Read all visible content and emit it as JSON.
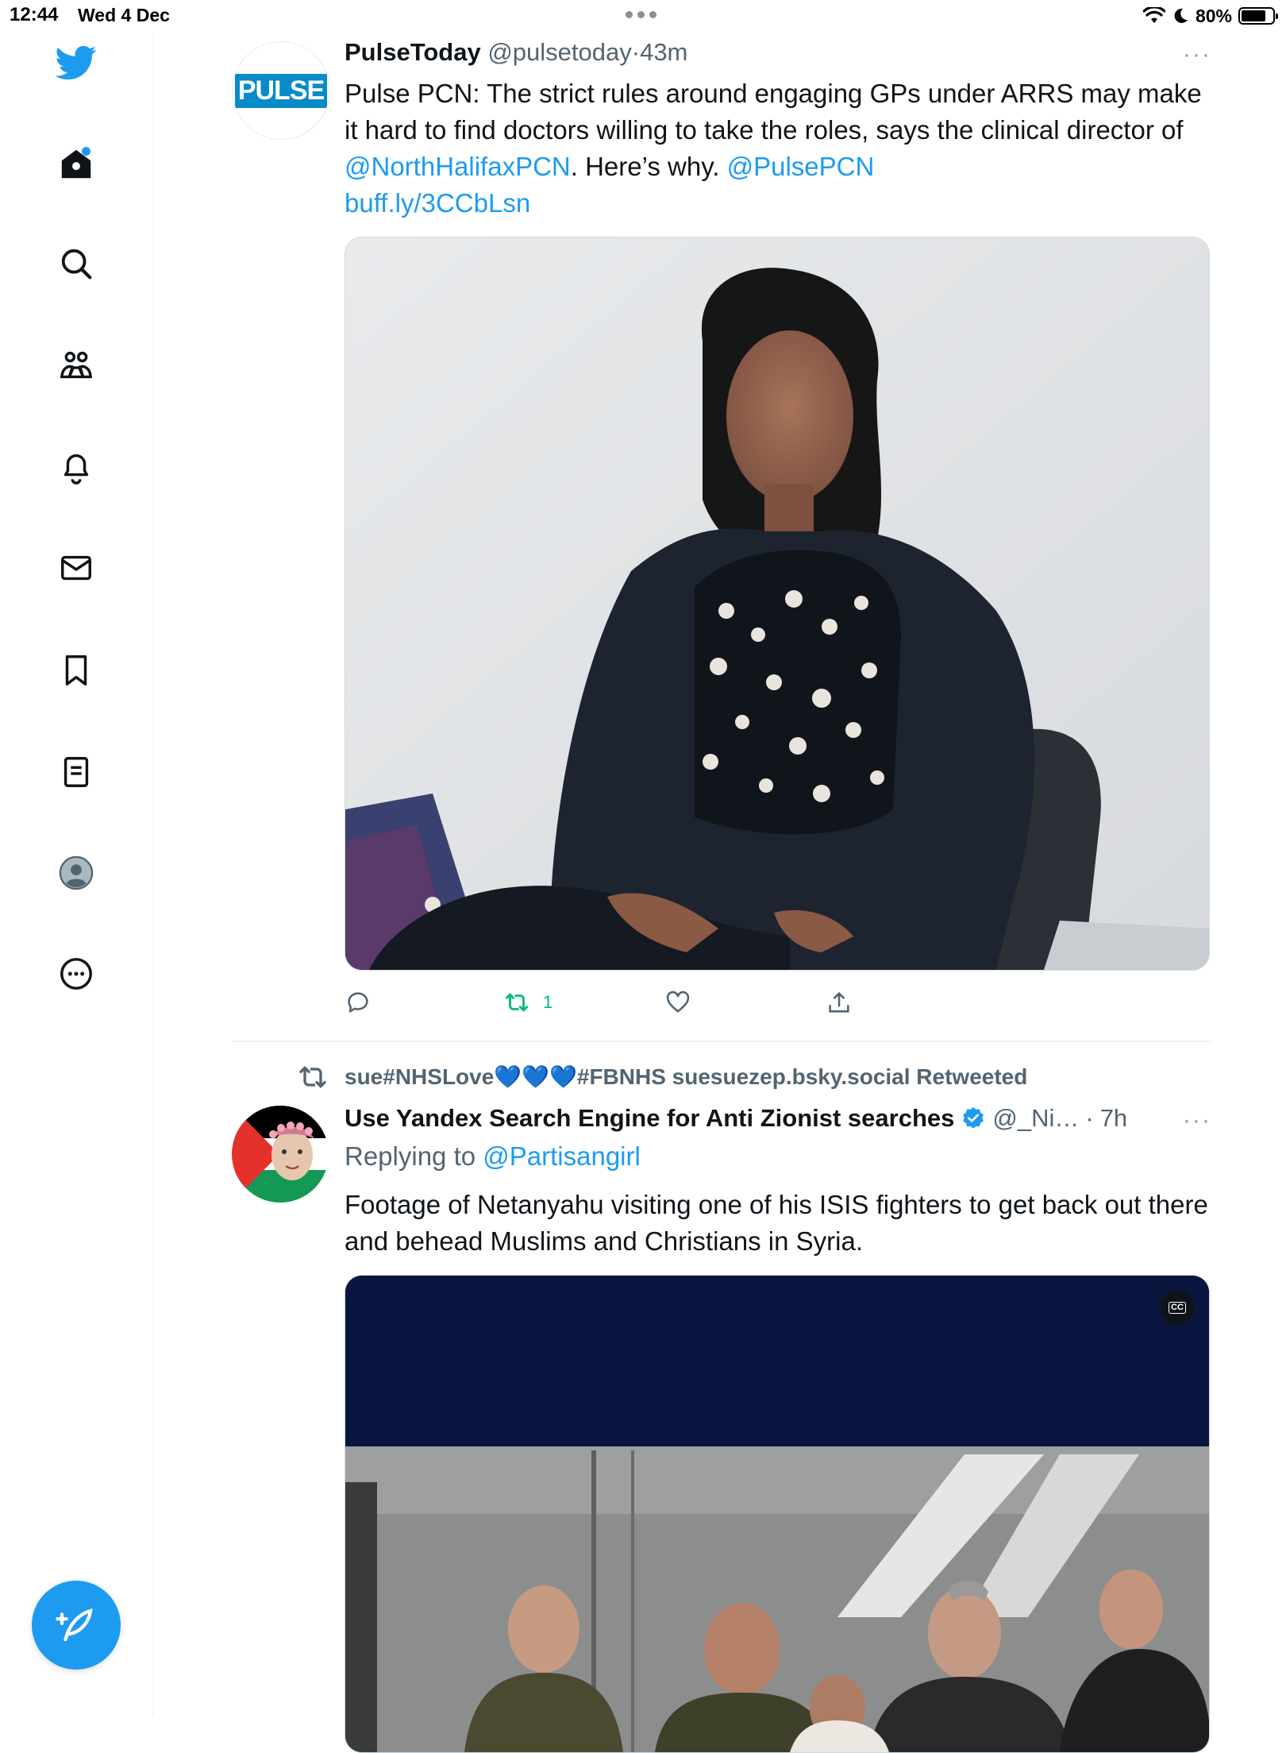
{
  "status_bar": {
    "time": "12:44",
    "date": "Wed 4 Dec",
    "battery": "80%",
    "battery_level": 0.8
  },
  "sidebar": {
    "items": [
      {
        "id": "twitter-logo",
        "icon": "twitter-bird-icon"
      },
      {
        "id": "home",
        "icon": "home-icon",
        "has_notification_dot": true
      },
      {
        "id": "explore",
        "icon": "search-icon"
      },
      {
        "id": "communities",
        "icon": "communities-icon"
      },
      {
        "id": "notifications",
        "icon": "bell-icon"
      },
      {
        "id": "messages",
        "icon": "envelope-icon"
      },
      {
        "id": "bookmarks",
        "icon": "bookmark-icon"
      },
      {
        "id": "lists",
        "icon": "list-icon"
      },
      {
        "id": "profile",
        "icon": "profile-avatar-icon"
      },
      {
        "id": "more",
        "icon": "more-circle-icon"
      }
    ],
    "compose_icon": "compose-feather-icon"
  },
  "tweets": [
    {
      "avatar_text": "PULSE",
      "display_name": "PulseToday",
      "handle": "@pulsetoday",
      "separator": "·",
      "time": "43m",
      "more": "···",
      "text_1": "Pulse PCN: The strict rules around engaging GPs under ARRS may make it hard to find doctors willing to take the roles, says the clinical director of ",
      "mention_1": "@NorthHalifaxPCN",
      "text_2": ". Here’s why. ",
      "mention_2": "@PulsePCN",
      "link": "buff.ly/3CCbLsn",
      "retweet_count": "1",
      "colors": {
        "retweeted": "#00ba7c",
        "link": "#1d9bf0"
      }
    },
    {
      "retweeted_by": "sue#NHSLove💙💙💙#FBNHS suesuezep.bsky.social Retweeted",
      "display_name": "Use Yandex Search Engine for Anti Zionist searches",
      "verified": true,
      "handle": "@_Ni…",
      "separator": "·",
      "time": "7h",
      "more": "···",
      "replying_to_label": "Replying to ",
      "replying_to_handle": "@Partisangirl",
      "text": "Footage of Netanyahu visiting one of his ISIS fighters to get back out there and behead Muslims and Christians in Syria.",
      "cc_label": "CC"
    }
  ]
}
